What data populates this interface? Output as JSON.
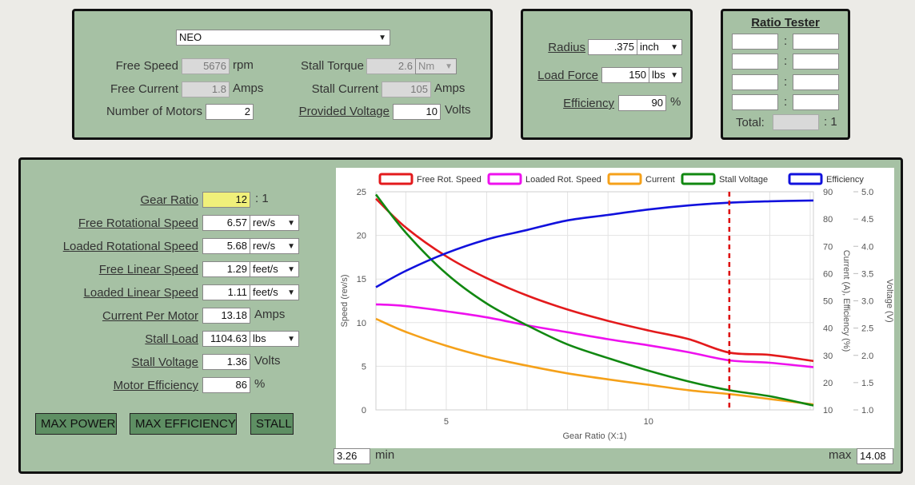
{
  "motor": {
    "selected_motor": "NEO",
    "free_speed_label": "Free Speed",
    "free_speed_value": "5676",
    "free_speed_unit": "rpm",
    "free_current_label": "Free Current",
    "free_current_value": "1.8",
    "free_current_unit": "Amps",
    "num_motors_label": "Number of Motors",
    "num_motors_value": "2",
    "stall_torque_label": "Stall Torque",
    "stall_torque_value": "2.6",
    "stall_torque_unit": "Nm",
    "stall_current_label": "Stall Current",
    "stall_current_value": "105",
    "stall_current_unit": "Amps",
    "voltage_label": "Provided Voltage",
    "voltage_value": "10",
    "voltage_unit": "Volts"
  },
  "load": {
    "radius_label": "Radius",
    "radius_value": ".375",
    "radius_unit": "inch",
    "load_force_label": "Load Force",
    "load_force_value": "150",
    "load_force_unit": "lbs",
    "efficiency_label": "Efficiency",
    "efficiency_value": "90",
    "efficiency_unit": "%"
  },
  "ratio_tester": {
    "title": "Ratio Tester",
    "separator": ":",
    "total_label": "Total:",
    "total_suffix": ": 1"
  },
  "results": {
    "gear_ratio_label": "Gear Ratio",
    "gear_ratio_value": "12",
    "gear_ratio_suffix": ": 1",
    "free_rot_label": "Free Rotational Speed",
    "free_rot_value": "6.57",
    "free_rot_unit": "rev/s",
    "loaded_rot_label": "Loaded Rotational Speed",
    "loaded_rot_value": "5.68",
    "loaded_rot_unit": "rev/s",
    "free_lin_label": "Free Linear Speed",
    "free_lin_value": "1.29",
    "free_lin_unit": "feet/s",
    "loaded_lin_label": "Loaded Linear Speed",
    "loaded_lin_value": "1.11",
    "loaded_lin_unit": "feet/s",
    "current_label": "Current Per Motor",
    "current_value": "13.18",
    "current_unit": "Amps",
    "stall_load_label": "Stall Load",
    "stall_load_value": "1104.63",
    "stall_load_unit": "lbs",
    "stall_voltage_label": "Stall Voltage",
    "stall_voltage_value": "1.36",
    "stall_voltage_unit": "Volts",
    "motor_eff_label": "Motor Efficiency",
    "motor_eff_value": "86",
    "motor_eff_unit": "%"
  },
  "buttons": {
    "max_power": "MAX POWER",
    "max_efficiency": "MAX EFFICIENCY",
    "stall": "STALL"
  },
  "range": {
    "min_value": "3.26",
    "min_label": "min",
    "max_label": "max",
    "max_value": "14.08"
  },
  "colors": {
    "panel": "#a6c1a4",
    "free_speed": "#e31a1c",
    "loaded_speed": "#ee11ee",
    "current": "#f5a11a",
    "stall_voltage": "#118811",
    "efficiency": "#1111dd",
    "marker": "#dd0000"
  },
  "chart_data": {
    "type": "line",
    "xlabel": "Gear Ratio (X:1)",
    "ylabel_left": "Speed (rev/s)",
    "ylabel_right1": "Current (A), Efficiency (%)",
    "ylabel_right2": "Voltage (V)",
    "xlim": [
      3.26,
      14.08
    ],
    "x_ticks": [
      5,
      10
    ],
    "ylim_left": [
      0,
      25
    ],
    "y_ticks_left": [
      0,
      5,
      10,
      15,
      20,
      25
    ],
    "ylim_right1": [
      10,
      90
    ],
    "y_ticks_right1": [
      10,
      20,
      30,
      40,
      50,
      60,
      70,
      80,
      90
    ],
    "ylim_right2": [
      1.0,
      5.0
    ],
    "y_ticks_right2": [
      "1.0",
      "1.5",
      "2.0",
      "2.5",
      "3.0",
      "3.5",
      "4.0",
      "4.5",
      "5.0"
    ],
    "grid": true,
    "legend_position": "top",
    "marker_x": 12,
    "x": [
      3.26,
      4,
      5,
      6,
      7,
      8,
      9,
      10,
      11,
      12,
      13,
      14.08
    ],
    "series": [
      {
        "name": "Free Rot. Speed",
        "axis": "left",
        "values": [
          24.2,
          20.9,
          17.6,
          15.1,
          13.1,
          11.5,
          10.2,
          9.1,
          8.1,
          6.57,
          6.3,
          5.6
        ]
      },
      {
        "name": "Loaded Rot. Speed",
        "axis": "left",
        "values": [
          12.1,
          11.9,
          11.3,
          10.6,
          9.7,
          8.9,
          8.1,
          7.4,
          6.6,
          5.68,
          5.4,
          4.9
        ]
      },
      {
        "name": "Current",
        "axis": "right1",
        "values": [
          43.4,
          38.6,
          33.5,
          29.4,
          26.2,
          23.4,
          21.2,
          19.2,
          17.2,
          15.8,
          14.0,
          12.0
        ]
      },
      {
        "name": "Stall Voltage",
        "axis": "right2",
        "values": [
          4.95,
          4.25,
          3.5,
          2.95,
          2.55,
          2.2,
          1.95,
          1.72,
          1.52,
          1.36,
          1.25,
          1.08
        ]
      },
      {
        "name": "Efficiency",
        "axis": "right1",
        "values": [
          55.0,
          61.0,
          67.5,
          72.5,
          76.0,
          79.5,
          81.5,
          83.5,
          85.0,
          86.0,
          86.5,
          86.8
        ]
      }
    ]
  }
}
